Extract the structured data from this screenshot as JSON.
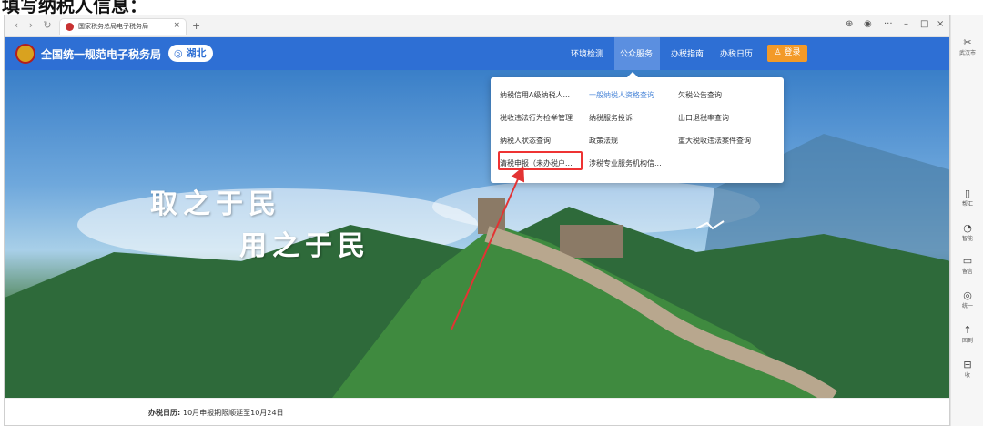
{
  "caption": "填写纳税人信息：",
  "browser": {
    "tab_title": "国家税务总局电子税务局",
    "tab_close": "×",
    "new_tab": "+",
    "win_minimize": "–",
    "win_maximize": "□",
    "win_close": "×",
    "more": "···"
  },
  "header": {
    "site_title": "全国统一规范电子税务局",
    "region": "湖北",
    "nav": [
      "环境检测",
      "公众服务",
      "办税指南",
      "办税日历"
    ],
    "login": "登录"
  },
  "hero": {
    "slogan_line1": "取之于民",
    "slogan_line2": "用之于民"
  },
  "dropdown": {
    "items": [
      "纳税信用A级纳税人...",
      "一般纳税人资格查询",
      "欠税公告查询",
      "税收违法行为检举管理",
      "纳税服务投诉",
      "出口退税率查询",
      "纳税人状态查询",
      "政策法规",
      "重大税收违法案件查询",
      "清税申报（未办税户...",
      "涉税专业服务机构信..."
    ]
  },
  "info_bar": {
    "label": "办税日历:",
    "text": "10月申报期限顺延至10月24日"
  },
  "right_panel": {
    "items": [
      "武汉市",
      "帮汇",
      "智能",
      "留言",
      "统一",
      "回到",
      "收"
    ]
  },
  "colors": {
    "header_blue": "#2e6fd4",
    "login_orange": "#f39a28",
    "highlight_red": "#e33333",
    "dropdown_link": "#4a86d8"
  }
}
